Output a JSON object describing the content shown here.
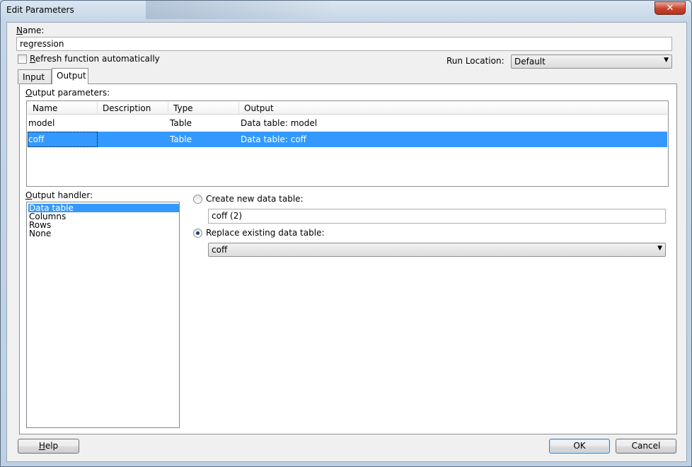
{
  "window": {
    "title": "Edit Parameters",
    "close_glyph": "✕"
  },
  "name_field": {
    "label_pre": "",
    "label_u": "N",
    "label_post": "ame:",
    "value": "regression"
  },
  "refresh": {
    "label_u": "R",
    "label_post": "efresh function automatically",
    "checked": false
  },
  "run_location": {
    "label": "Run Location:",
    "value": "Default"
  },
  "tabs": [
    {
      "label": "Input"
    },
    {
      "label": "Output"
    }
  ],
  "output_params": {
    "label_u": "O",
    "label_post": "utput parameters:",
    "columns": [
      "Name",
      "Description",
      "Type",
      "Output"
    ],
    "rows": [
      {
        "name": "model",
        "description": "",
        "type": "Table",
        "output": "Data table: model"
      },
      {
        "name": "coff",
        "description": "",
        "type": "Table",
        "output": "Data table: coff"
      }
    ]
  },
  "output_handler": {
    "label_u": "O",
    "label_post": "utput handler:",
    "items": [
      "Data table",
      "Columns",
      "Rows",
      "None"
    ]
  },
  "create_new": {
    "label": "Create new data table:",
    "value": "coff (2)"
  },
  "replace_existing": {
    "label": "Replace existing data table:",
    "value": "coff"
  },
  "buttons": {
    "help_u": "H",
    "help_post": "elp",
    "ok": "OK",
    "cancel": "Cancel"
  },
  "icons": {
    "dropdown_arrow": "▼"
  },
  "colors": {
    "selection": "#3399ff",
    "close": "#c7422c"
  }
}
